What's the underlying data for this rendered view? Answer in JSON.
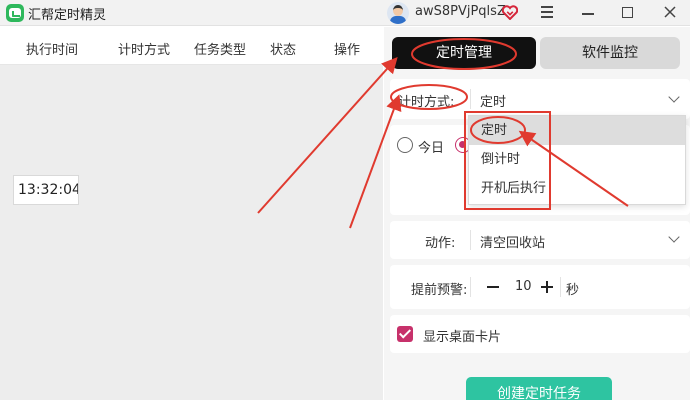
{
  "app": {
    "title": "汇帮定时精灵",
    "username": "awS8PVjPqlsZ"
  },
  "window_controls": [
    "menu-icon",
    "minimize-icon",
    "maximize-icon",
    "close-icon"
  ],
  "table": {
    "columns": [
      "执行时间",
      "计时方式",
      "任务类型",
      "状态",
      "操作"
    ]
  },
  "tabs": [
    {
      "label": "定时管理",
      "active": true
    },
    {
      "label": "软件监控",
      "active": false
    }
  ],
  "form": {
    "timing_label": "计时方式:",
    "timing_value": "定时",
    "timing_options": [
      "定时",
      "倒计时",
      "开机后执行"
    ],
    "selected_option": "定时",
    "date_option": "今日",
    "time_value": "13:32:04",
    "action_label": "动作:",
    "action_value": "清空回收站",
    "warning_label": "提前预警:",
    "warning_value": "10",
    "warning_unit": "秒",
    "show_card_label": "显示桌面卡片",
    "show_card_checked": true,
    "create_button": "创建定时任务"
  },
  "colors": {
    "accent": "#c7316b",
    "active_tab": "#111111",
    "create_button": "#2ec4a1",
    "annotation": "#e03a2f"
  }
}
